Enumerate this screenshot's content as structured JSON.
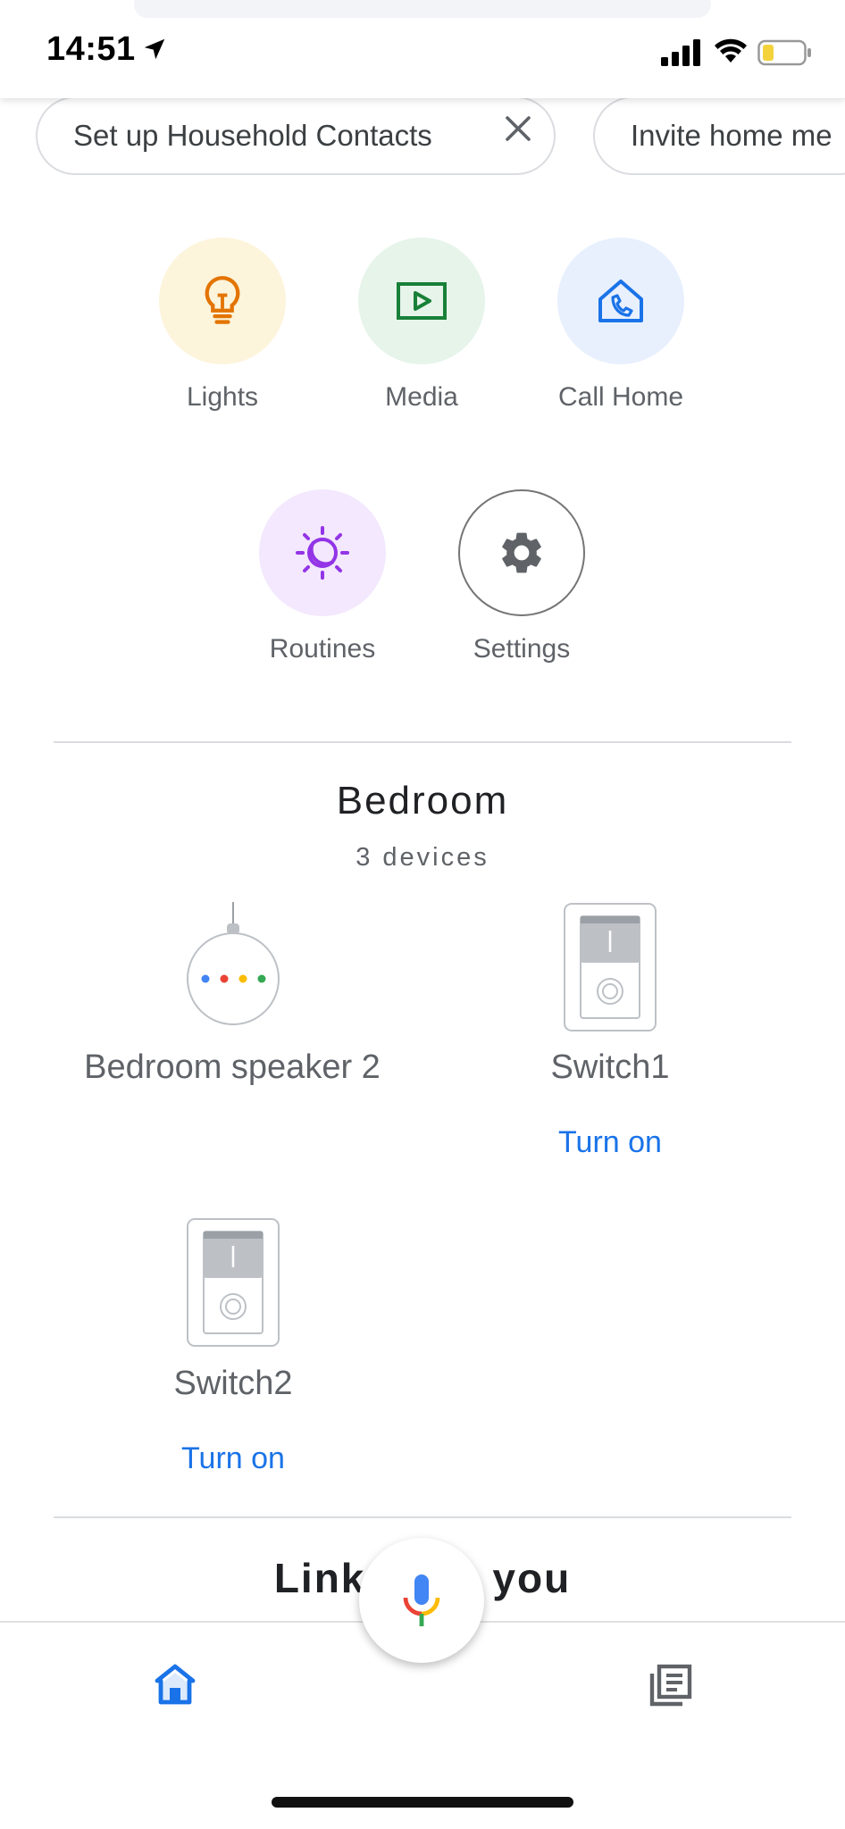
{
  "status_bar": {
    "time": "14:51",
    "battery_color": "#f3d23c"
  },
  "chips": [
    {
      "label": "Set up Household Contacts"
    },
    {
      "label": "Invite home me"
    }
  ],
  "actions": [
    {
      "label": "Lights",
      "icon": "lightbulb-icon",
      "bg": "#fdf4dc",
      "color": "#e37400"
    },
    {
      "label": "Media",
      "icon": "play-box-icon",
      "bg": "#e6f4ea",
      "color": "#188038"
    },
    {
      "label": "Call Home",
      "icon": "house-phone-icon",
      "bg": "#e8f0fe",
      "color": "#1a73e8"
    },
    {
      "label": "Routines",
      "icon": "sun-moon-icon",
      "bg": "#f3e8fd",
      "color": "#9334e6"
    },
    {
      "label": "Settings",
      "icon": "gear-icon",
      "bg": "#ffffff",
      "color": "#5f6368"
    }
  ],
  "room": {
    "title": "Bedroom",
    "subtitle": "3 devices",
    "devices": [
      {
        "name": "Bedroom speaker 2",
        "icon": "smart-speaker-icon"
      },
      {
        "name": "Switch1",
        "icon": "switch-icon",
        "action": "Turn on"
      },
      {
        "name": "Switch2",
        "icon": "switch-icon",
        "action": "Turn on"
      }
    ]
  },
  "next_section": {
    "title_left": "Link",
    "title_right": "you"
  },
  "bottom_nav": {
    "items": [
      {
        "icon": "home-icon",
        "active": true
      },
      {
        "icon": "feed-icon",
        "active": false
      }
    ],
    "accent": "#1a73e8"
  }
}
